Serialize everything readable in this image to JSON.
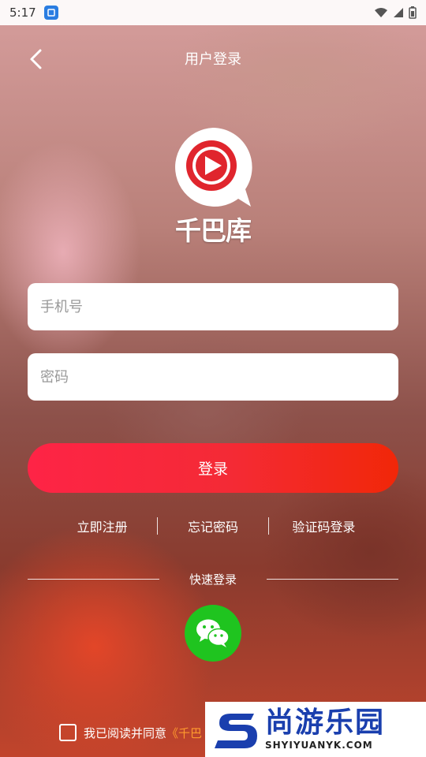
{
  "status_bar": {
    "time": "5:17"
  },
  "header": {
    "title": "用户登录"
  },
  "logo": {
    "text": "千巴库"
  },
  "form": {
    "phone_placeholder": "手机号",
    "password_placeholder": "密码",
    "login_label": "登录"
  },
  "links": {
    "register": "立即注册",
    "forgot": "忘记密码",
    "sms_login": "验证码登录"
  },
  "quick_login": {
    "label": "快速登录"
  },
  "agreement": {
    "text": "我已阅读并同意",
    "link_text": "《千巴"
  },
  "watermark": {
    "title": "尚游乐园",
    "subtitle": "SHYIYUANYK.COM"
  },
  "colors": {
    "accent": "#f42a35",
    "wechat": "#1fc41f",
    "link": "#ff9a2e",
    "watermark": "#1a3fae"
  },
  "icons": [
    "back-arrow-icon",
    "play-icon",
    "wechat-icon",
    "wifi-icon",
    "signal-icon",
    "battery-icon"
  ]
}
